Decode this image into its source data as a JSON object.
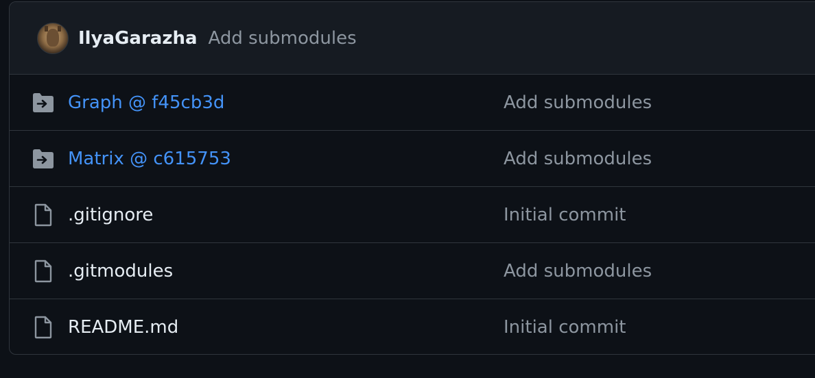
{
  "latest_commit": {
    "author": "IlyaGarazha",
    "message": "Add submodules"
  },
  "files": [
    {
      "name": "Graph @ f45cb3d",
      "type": "submodule",
      "icon": "submodule-folder-icon",
      "message": "Add submodules"
    },
    {
      "name": "Matrix @ c615753",
      "type": "submodule",
      "icon": "submodule-folder-icon",
      "message": "Add submodules"
    },
    {
      "name": ".gitignore",
      "type": "file",
      "icon": "file-icon",
      "message": "Initial commit"
    },
    {
      "name": ".gitmodules",
      "type": "file",
      "icon": "file-icon",
      "message": "Add submodules"
    },
    {
      "name": "README.md",
      "type": "file",
      "icon": "file-icon",
      "message": "Initial commit"
    }
  ],
  "colors": {
    "background": "#0d1117",
    "header_background": "#161b22",
    "border": "#30363d",
    "link": "#4493f8",
    "text": "#e6edf3",
    "muted": "#8d96a0",
    "icon": "#8d96a0"
  }
}
